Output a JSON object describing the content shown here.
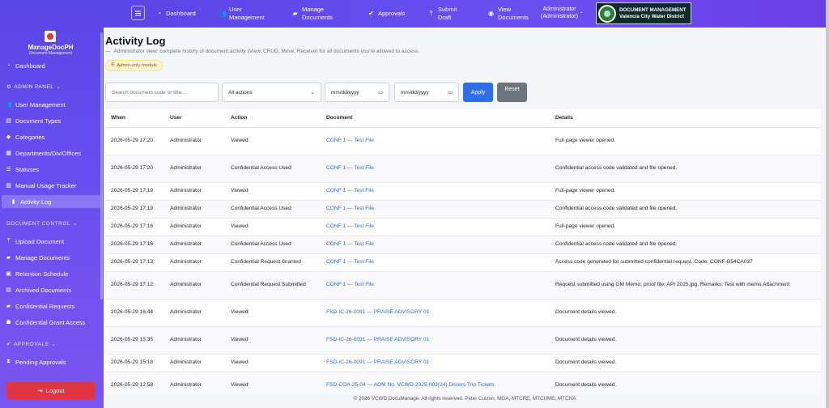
{
  "topbar": {
    "nav": [
      {
        "icon": "dashboard-icon",
        "label": "Dashboard"
      },
      {
        "icon": "users-icon",
        "label": "User Management"
      },
      {
        "icon": "folder-icon",
        "label": "Manage Documents"
      },
      {
        "icon": "check-circle-icon",
        "label": "Approvals"
      },
      {
        "icon": "upload-icon",
        "label": "Submit Draft"
      },
      {
        "icon": "eye-icon",
        "label": "View Documents"
      }
    ],
    "user_name": "Administrator",
    "user_role": "(Administrator)",
    "brand_line1": "DOCUMENT MANAGEMENT",
    "brand_line2": "Valencia City Water District"
  },
  "sidebar": {
    "app_name": "ManageDocPH",
    "app_sub": "Document Management",
    "dashboard": "Dashboard",
    "admin_section": "ADMIN PANEL",
    "admin_items": [
      "User Management",
      "Document Types",
      "Categories",
      "Departments/Div/Offices",
      "Statuses",
      "Manual Usage Tracker",
      "Activity Log"
    ],
    "doc_section": "DOCUMENT CONTROL",
    "doc_items": [
      "Upload Document",
      "Manage Documents",
      "Retention Schedule",
      "Archived Documents",
      "Confidential Requests",
      "Confidential Grant Access"
    ],
    "approvals_section": "APPROVALS",
    "approvals_items": [
      "Pending Approvals"
    ],
    "logout": "Logout"
  },
  "main": {
    "title": "Activity Log",
    "subtitle": "Administrator view: complete history of document activity (View, CRUD, Move, Receive) for all documents you're allowed to access.",
    "badge": "Admin-only module",
    "search_placeholder": "Search document code or title...",
    "action_select": "All actions",
    "date_from": "mm/dd/yyyy",
    "date_to": "mm/dd/yyyy",
    "apply": "Apply",
    "reset": "Reset",
    "columns": [
      "When",
      "User",
      "Action",
      "Document",
      "Details"
    ],
    "rows": [
      {
        "when": "2026-05-29 17:20",
        "user": "Administrator",
        "action": "Viewed",
        "doc": "CONF 1 — Test File",
        "details": "Full-page viewer opened.",
        "tall": true
      },
      {
        "when": "2026-05-29 17:20",
        "user": "Administrator",
        "action": "Confidential Access Used",
        "doc": "CONF 1 — Test File",
        "details": "Confidential access code validated and file opened.",
        "tall": true
      },
      {
        "when": "2026-05-29 17:19",
        "user": "Administrator",
        "action": "Viewed",
        "doc": "CONF 1 — Test File",
        "details": "Full-page viewer opened.",
        "tall": false
      },
      {
        "when": "2026-05-29 17:19",
        "user": "Administrator",
        "action": "Confidential Access Used",
        "doc": "CONF 1 — Test File",
        "details": "Confidential access code validated and file opened.",
        "tall": false
      },
      {
        "when": "2026-05-29 17:16",
        "user": "Administrator",
        "action": "Viewed",
        "doc": "CONF 1 — Test File",
        "details": "Full-page viewer opened.",
        "tall": false
      },
      {
        "when": "2026-05-29 17:16",
        "user": "Administrator",
        "action": "Confidential Access Used",
        "doc": "CONF 1 — Test File",
        "details": "Confidential access code validated and file opened.",
        "tall": false
      },
      {
        "when": "2026-05-29 17:13",
        "user": "Administrator",
        "action": "Confidential Request Granted",
        "doc": "CONF 1 — Test File",
        "details": "Access code generated for submitted confidential request. Code: CONF-B54CA037",
        "tall": false
      },
      {
        "when": "2026-05-29 17:12",
        "user": "Administrator",
        "action": "Confidential Request Submitted",
        "doc": "CONF 1 — Test File",
        "details": "Request submitted using GM Memo; proof file: API 2025.jpg. Remarks: Test with memo Attachment",
        "tall": true
      },
      {
        "when": "2026-05-29 16:44",
        "user": "Administrator",
        "action": "Viewed",
        "doc": "FSD-IC-26-0091 — PRAISE ADVISORY 01",
        "details": "Document details viewed.",
        "tall": true
      },
      {
        "when": "2026-05-29 15:35",
        "user": "Administrator",
        "action": "Viewed",
        "doc": "FSD-IC-26-0091 — PRAISE ADVISORY 01",
        "details": "Document details viewed.",
        "tall": true
      },
      {
        "when": "2026-05-29 15:18",
        "user": "Administrator",
        "action": "Viewed",
        "doc": "FSD-IC-26-0091 — PRAISE ADVISORY 01",
        "details": "Document details viewed.",
        "tall": false
      },
      {
        "when": "2026-05-29 12:58",
        "user": "Administrator",
        "action": "Viewed",
        "doc": "FSD-COA-25-04 — AOM No. VCWD-2025-003(24) Drivers Trip Tickets",
        "details": "Document details viewed.",
        "tall": true
      }
    ],
    "footer": "© 2026 VCWD DocuManage. All rights reserved. Peter Cuizon, MGA, MTCRE, MTCUME, MTCNA"
  }
}
